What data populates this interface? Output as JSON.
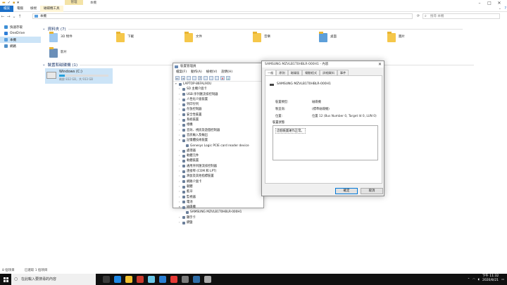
{
  "explorer": {
    "context_tab": "管理",
    "window_title": "本機",
    "ribbon_tabs": [
      "檔案",
      "電腦",
      "檢視",
      "磁碟機工具"
    ],
    "address": "本機",
    "search_placeholder": "搜尋 本機",
    "nav": [
      {
        "label": "快速存取",
        "color": "#3d8fd6"
      },
      {
        "label": "OneDrive",
        "color": "#2f7fd8"
      },
      {
        "label": "本機",
        "color": "#5aa0e0",
        "selected": true
      },
      {
        "label": "網路",
        "color": "#4f8fc8"
      }
    ],
    "group_folders": "資料夾 (7)",
    "folders": [
      "3D 物件",
      "下載",
      "文件",
      "音樂",
      "桌面",
      "圖片",
      "影片"
    ],
    "group_drives": "裝置和磁碟機 (1)",
    "drive": {
      "name": "Windows (C:)",
      "space": "剩餘 832 GB，共 933 GB",
      "used_fraction": 0.11
    },
    "status": [
      "8 個項目",
      "已選取 1 個項目"
    ]
  },
  "devmgr": {
    "title": "裝置管理員",
    "menu": [
      "檔案(F)",
      "動作(A)",
      "檢視(V)",
      "說明(H)"
    ],
    "tree": [
      {
        "label": "LAPTOP-86FAL9OU",
        "level": 0,
        "arrow": "▾"
      },
      {
        "label": "SD 主機介面卡",
        "level": 1,
        "arrow": "›"
      },
      {
        "label": "USB 序列匯流排控制器",
        "level": 1,
        "arrow": "›"
      },
      {
        "label": "人性化介面裝置",
        "level": 1,
        "arrow": "›"
      },
      {
        "label": "列印佇列",
        "level": 1,
        "arrow": "›"
      },
      {
        "label": "存放控制器",
        "level": 1,
        "arrow": "›"
      },
      {
        "label": "安全性裝置",
        "level": 1,
        "arrow": "›"
      },
      {
        "label": "系統裝置",
        "level": 1,
        "arrow": "›"
      },
      {
        "label": "相機",
        "level": 1,
        "arrow": "›"
      },
      {
        "label": "音效、視訊及遊戲控制器",
        "level": 1,
        "arrow": "›"
      },
      {
        "label": "音訊輸入及輸出",
        "level": 1,
        "arrow": "›"
      },
      {
        "label": "記憶體技術裝置",
        "level": 1,
        "arrow": "▾"
      },
      {
        "label": "Genesys Logic PCIE card reader device",
        "level": 2,
        "arrow": ""
      },
      {
        "label": "處理器",
        "level": 1,
        "arrow": "›"
      },
      {
        "label": "軟體元件",
        "level": 1,
        "arrow": "›"
      },
      {
        "label": "軟體裝置",
        "level": 1,
        "arrow": "›"
      },
      {
        "label": "通用序列匯流排控制器",
        "level": 1,
        "arrow": "›"
      },
      {
        "label": "連接埠 (COM 和 LPT)",
        "level": 1,
        "arrow": "›"
      },
      {
        "label": "滑鼠及其他指標裝置",
        "level": 1,
        "arrow": "›"
      },
      {
        "label": "網路介面卡",
        "level": 1,
        "arrow": "›"
      },
      {
        "label": "韌體",
        "level": 1,
        "arrow": "›"
      },
      {
        "label": "藍牙",
        "level": 1,
        "arrow": "›"
      },
      {
        "label": "監視器",
        "level": 1,
        "arrow": "›"
      },
      {
        "label": "電池",
        "level": 1,
        "arrow": "›"
      },
      {
        "label": "磁碟機",
        "level": 1,
        "arrow": "▾"
      },
      {
        "label": "SAMSUNG MZVLB1T0HBLR-000H1",
        "level": 2,
        "arrow": ""
      },
      {
        "label": "顯示卡",
        "level": 1,
        "arrow": "›"
      },
      {
        "label": "鍵盤",
        "level": 1,
        "arrow": "›"
      }
    ]
  },
  "props": {
    "title": "SAMSUNG MZVLB1T0HBLR-000H1 - 內容",
    "tabs": [
      "一般",
      "原則",
      "磁碟區",
      "驅動程式",
      "詳細資料",
      "事件"
    ],
    "device_name": "SAMSUNG MZVLB1T0HBLR-000H1",
    "fields": [
      {
        "label": "裝置類型:",
        "value": "磁碟機"
      },
      {
        "label": "製造商:",
        "value": "(標準磁碟機)"
      },
      {
        "label": "位置:",
        "value": "位置 12 (Bus Number 0, Target Id 0, LUN 0)"
      }
    ],
    "status_label": "裝置狀態",
    "status_text": "這個裝置運作正常。",
    "ok": "確定",
    "cancel": "取消"
  },
  "taskbar": {
    "search": "在此輸入要搜尋的內容",
    "app_colors": [
      "#3a3a3a",
      "#1e88e5",
      "#f2c12e",
      "#cc3a2e",
      "#6ac7e8",
      "#2a7fd4",
      "#e53935",
      "#7b7b7b",
      "#2f6ea8",
      "#aaaaaa"
    ],
    "time": "下午 11:32",
    "date": "2020/8/21"
  }
}
